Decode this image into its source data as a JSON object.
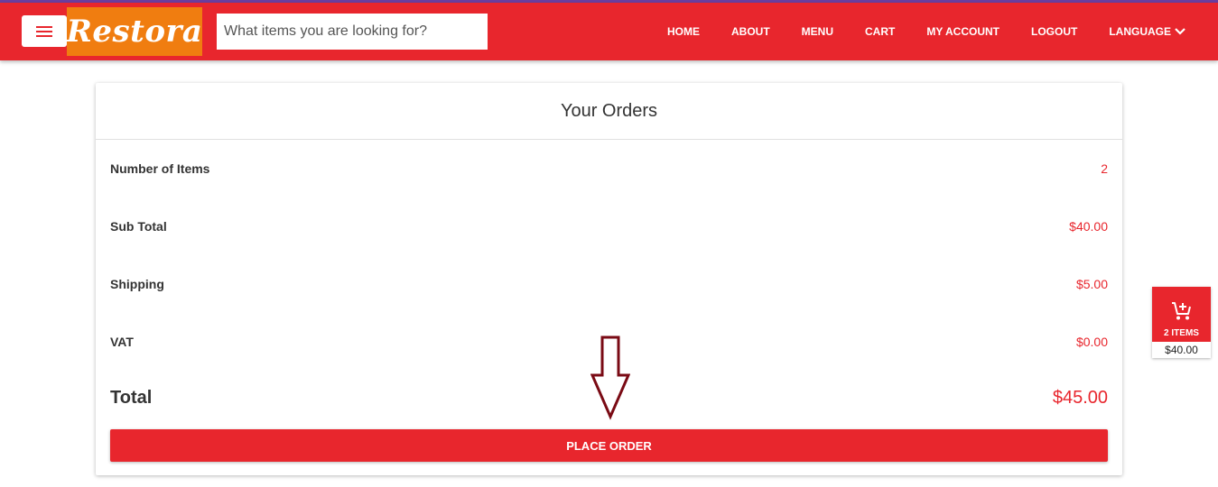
{
  "header": {
    "logo_text": "Restora",
    "search_placeholder": "What items you are looking for?",
    "nav": [
      "HOME",
      "ABOUT",
      "MENU",
      "CART",
      "MY ACCOUNT",
      "LOGOUT",
      "LANGUAGE"
    ]
  },
  "orders": {
    "title": "Your Orders",
    "rows": [
      {
        "label": "Number of Items",
        "value": "2"
      },
      {
        "label": "Sub Total",
        "value": "$40.00"
      },
      {
        "label": "Shipping",
        "value": "$5.00"
      },
      {
        "label": "VAT",
        "value": "$0.00"
      }
    ],
    "total_label": "Total",
    "total_value": "$45.00",
    "place_order_label": "PLACE ORDER"
  },
  "cart_widget": {
    "count_label": "2 ITEMS",
    "price": "$40.00"
  },
  "colors": {
    "brand_red": "#e8262d",
    "logo_orange": "#f07d10",
    "annotation_arrow": "#7a0a14"
  },
  "icons": [
    "hamburger-icon",
    "chevron-down-icon",
    "cart-add-icon",
    "down-arrow-annotation"
  ]
}
